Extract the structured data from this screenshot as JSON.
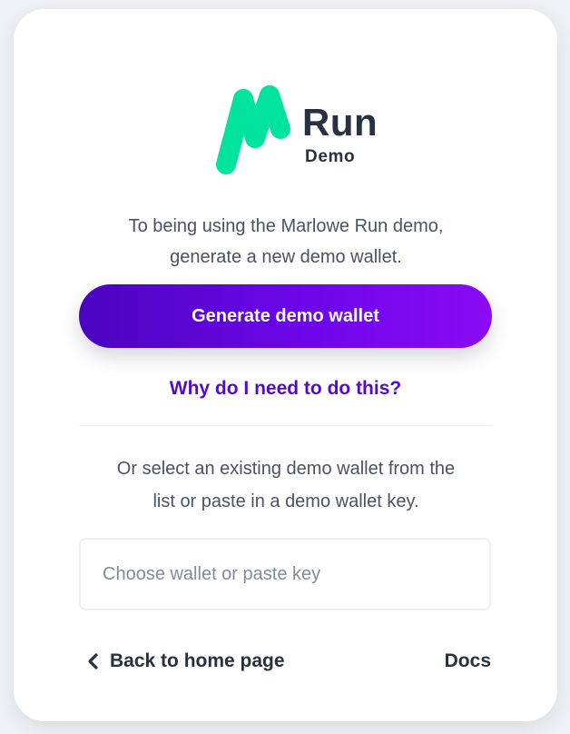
{
  "logo": {
    "title": "Run",
    "subtitle": "Demo",
    "icon": "marlowe-m-logo-icon",
    "color": "#00e39c"
  },
  "intro": {
    "line1": "To being using the Marlowe Run demo,",
    "line2": "generate a new demo wallet."
  },
  "generate_button": {
    "label": "Generate demo wallet"
  },
  "why_link": {
    "label": "Why do I need to do this?"
  },
  "existing": {
    "line1": "Or select an existing demo wallet from the",
    "line2": "list or paste in a demo wallet key."
  },
  "wallet_input": {
    "value": "",
    "placeholder": "Choose wallet or paste key"
  },
  "footer": {
    "back_label": "Back to home page",
    "back_icon": "chevron-left-icon",
    "docs_label": "Docs"
  },
  "colors": {
    "accent": "#5609c9",
    "button_gradient_start": "#4b04c0",
    "button_gradient_end": "#8a0af6",
    "text_dark": "#283142",
    "text_body": "#4a5263"
  }
}
